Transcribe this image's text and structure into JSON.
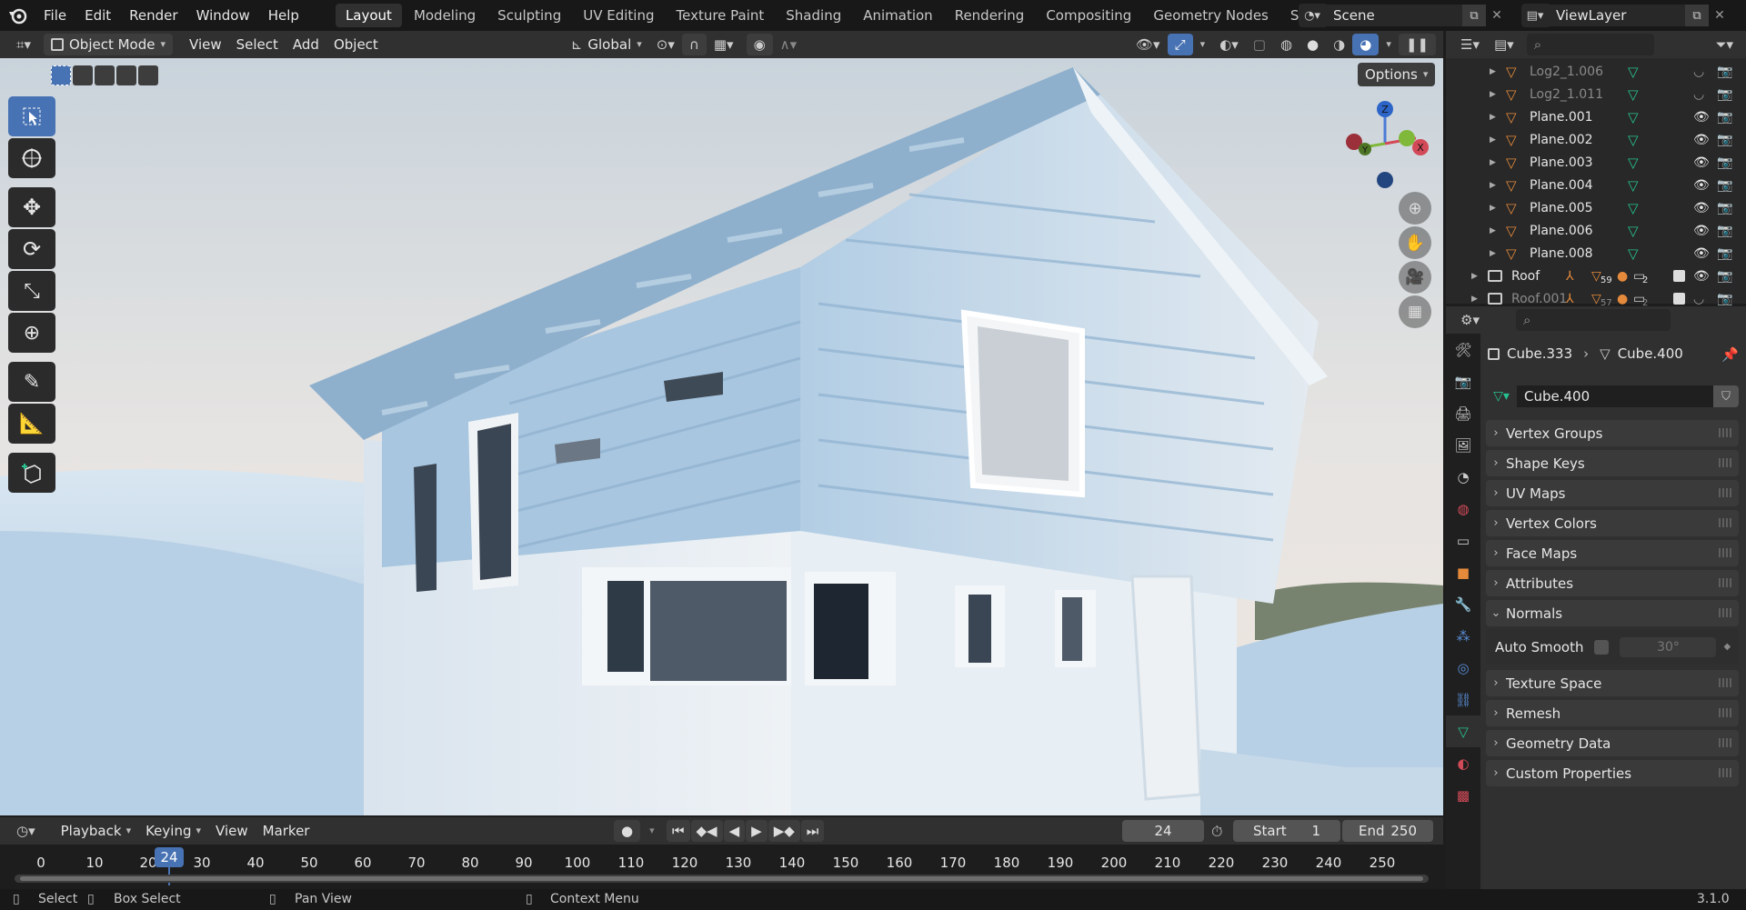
{
  "menus": [
    "File",
    "Edit",
    "Render",
    "Window",
    "Help"
  ],
  "workspaces": [
    "Layout",
    "Modeling",
    "Sculpting",
    "UV Editing",
    "Texture Paint",
    "Shading",
    "Animation",
    "Rendering",
    "Compositing",
    "Geometry Nodes",
    "Scripting"
  ],
  "active_workspace": "Layout",
  "scene": "Scene",
  "view_layer": "ViewLayer",
  "viewport_header": {
    "mode": "Object Mode",
    "view": "View",
    "select": "Select",
    "add": "Add",
    "object": "Object",
    "orientation": "Global",
    "options": "Options"
  },
  "gizmo": {
    "z": "Z",
    "y": "Y",
    "x": "X"
  },
  "outliner": [
    {
      "name": "Log2_1.006",
      "dim": true
    },
    {
      "name": "Log2_1.011",
      "dim": true
    },
    {
      "name": "Plane.001",
      "dim": false
    },
    {
      "name": "Plane.002",
      "dim": false
    },
    {
      "name": "Plane.003",
      "dim": false
    },
    {
      "name": "Plane.004",
      "dim": false
    },
    {
      "name": "Plane.005",
      "dim": false
    },
    {
      "name": "Plane.006",
      "dim": false
    },
    {
      "name": "Plane.008",
      "dim": false
    },
    {
      "name": "Roof",
      "dim": false,
      "badge1": "59",
      "badge2": "2"
    },
    {
      "name": "Roof.001",
      "dim": true,
      "badge1": "57",
      "badge2": "2"
    }
  ],
  "properties": {
    "breadcrumb_object": "Cube.333",
    "breadcrumb_mesh": "Cube.400",
    "mesh_name": "Cube.400",
    "panels": [
      "Vertex Groups",
      "Shape Keys",
      "UV Maps",
      "Vertex Colors",
      "Face Maps",
      "Attributes",
      "Normals",
      "Texture Space",
      "Remesh",
      "Geometry Data",
      "Custom Properties"
    ],
    "auto_smooth_label": "Auto Smooth",
    "auto_smooth_angle": "30°"
  },
  "timeline": {
    "playback": "Playback",
    "keying": "Keying",
    "view": "View",
    "marker": "Marker",
    "current_frame": "24",
    "start_label": "Start",
    "start": "1",
    "end_label": "End",
    "end": "250",
    "ticks": [
      "0",
      "10",
      "20",
      "30",
      "40",
      "50",
      "60",
      "70",
      "80",
      "90",
      "100",
      "110",
      "120",
      "130",
      "140",
      "150",
      "160",
      "170",
      "180",
      "190",
      "200",
      "210",
      "220",
      "230",
      "240",
      "250"
    ]
  },
  "status": {
    "select": "Select",
    "box_select": "Box Select",
    "pan_view": "Pan View",
    "context_menu": "Context Menu",
    "version": "3.1.0"
  },
  "colors": {
    "accent": "#4772b3",
    "mesh_icon": "#e58a3b",
    "data_icon": "#26c28f"
  }
}
